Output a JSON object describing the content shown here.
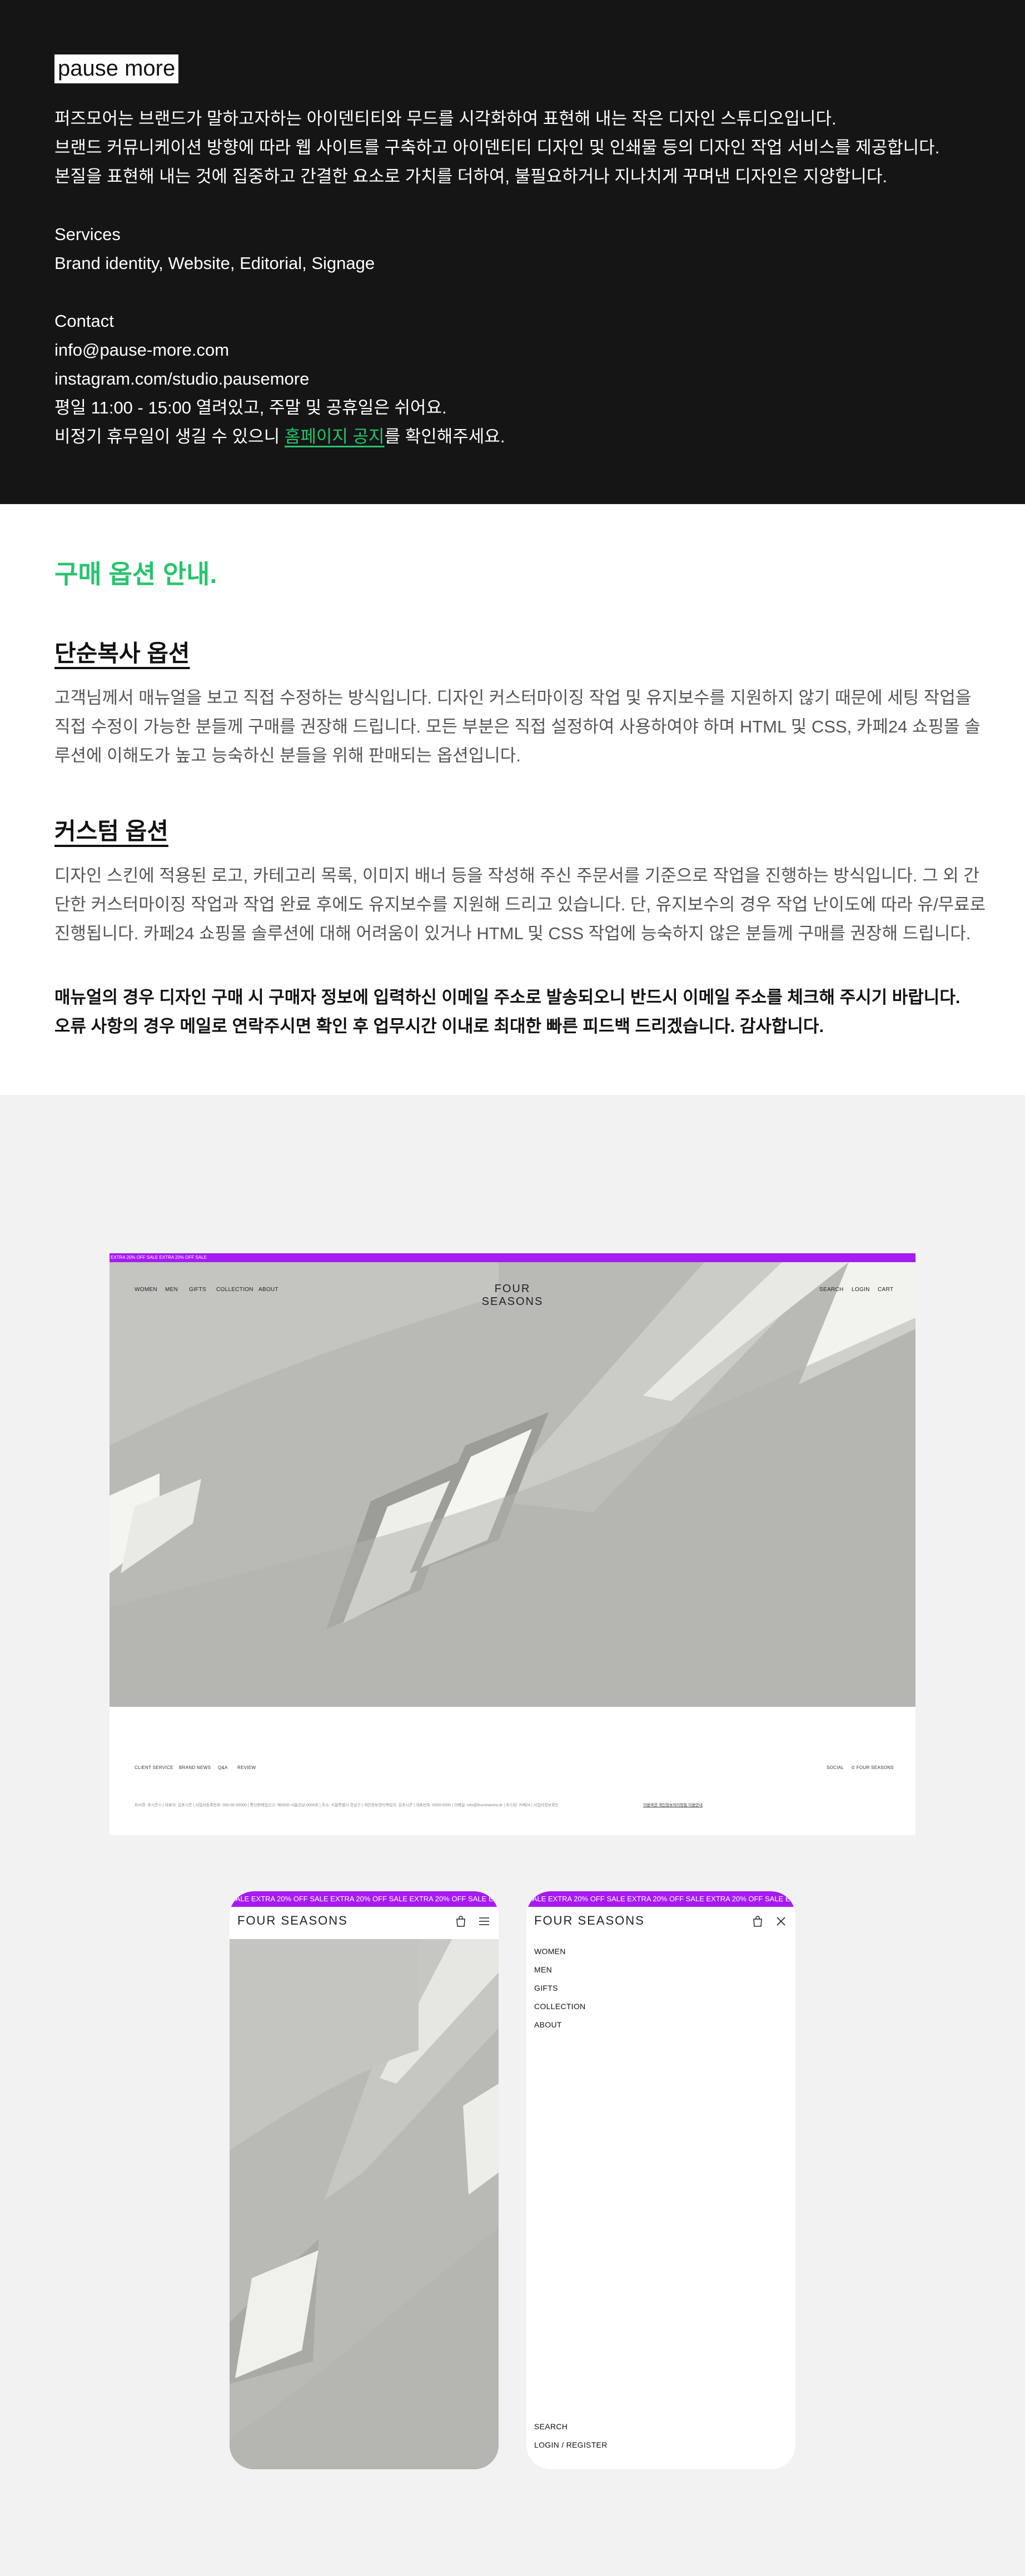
{
  "studio": {
    "logo": "pause more",
    "intro": [
      "퍼즈모어는 브랜드가 말하고자하는 아이덴티티와 무드를 시각화하여 표현해 내는 작은 디자인 스튜디오입니다.",
      "브랜드 커뮤니케이션 방향에 따라 웹 사이트를 구축하고 아이덴티티 디자인 및 인쇄물 등의 디자인 작업 서비스를 제공합니다.",
      "본질을 표현해 내는 것에 집중하고 간결한 요소로 가치를 더하여, 불필요하거나 지나치게 꾸며낸 디자인은 지양합니다."
    ],
    "services_label": "Services",
    "services": "Brand identity, Website, Editorial, Signage",
    "contact_label": "Contact",
    "email": "info@pause-more.com",
    "instagram": "instagram.com/studio.pausemore",
    "hours": "평일 11:00 - 15:00 열려있고, 주말 및 공휴일은 쉬어요.",
    "holiday_prefix": "비정기 휴무일이 생길 수 있으니 ",
    "holiday_link": "홈페이지 공지",
    "holiday_suffix": "를 확인해주세요."
  },
  "purchase": {
    "title": "구매 옵션 안내.",
    "options": [
      {
        "title": "단순복사 옵션",
        "text": "고객님께서 매뉴얼을 보고 직접 수정하는 방식입니다. 디자인 커스터마이징 작업 및 유지보수를 지원하지 않기 때문에 세팅 작업을 직접 수정이 가능한 분들께 구매를 권장해 드립니다. 모든 부분은 직접 설정하여 사용하여야 하며 HTML 및 CSS, 카페24 쇼핑몰 솔루션에 이해도가 높고 능숙하신 분들을 위해 판매되는 옵션입니다."
      },
      {
        "title": "커스텀 옵션",
        "text": "디자인 스킨에 적용된 로고, 카테고리 목록, 이미지 배너 등을 작성해 주신 주문서를 기준으로 작업을 진행하는 방식입니다. 그 외 간단한 커스터마이징 작업과 작업 완료 후에도 유지보수를 지원해 드리고 있습니다. 단, 유지보수의 경우 작업 난이도에 따라 유/무료로 진행됩니다. 카페24 쇼핑몰 솔루션에 대해 어려움이 있거나 HTML 및 CSS 작업에 능숙하지 않은 분들께 구매를 권장해 드립니다."
      }
    ],
    "notice": [
      "매뉴얼의 경우 디자인 구매 시 구매자 정보에 입력하신 이메일 주소로 발송되오니 반드시 이메일 주소를 체크해 주시기 바랍니다.",
      "오류 사항의 경우 메일로 연락주시면 확인 후 업무시간 이내로 최대한 빠른 피드백 드리겠습니다. 감사합니다."
    ]
  },
  "desktop": {
    "promo": "EXTRA 20% OFF SALE     EXTRA 20% OFF SALE",
    "nav_left": [
      "WOMEN",
      "MEN",
      "GIFTS",
      "COLLECTION",
      "ABOUT"
    ],
    "logo": "FOUR SEASONS",
    "nav_right": [
      "SEARCH",
      "LOGIN",
      "CART"
    ],
    "footer_left": [
      "CLIENT SERVICE",
      "BRAND NEWS",
      "Q&A",
      "REVIEW"
    ],
    "footer_right": [
      "SOCIAL",
      "© FOUR SEASONS"
    ],
    "footer_info": "회사명: 포시즌스   |   대표자: 김포시즌   |   사업자등록번호: 000-00-00000   |   통신판매업신고: 제0000-서울강남-0000호   |   주소: 서울특별시 강남구   |   개인정보관리책임자: 김포시즌   |   대표번호: 0000-0000   |   이메일: info@fourseasons.kr   |   호스팅: 카페24   |   사업자정보확인",
    "footer_links": "이용약관   개인정보처리방침   이용안내"
  },
  "mobile": {
    "promo": "SALE   EXTRA 20% OFF SALE   EXTRA 20% OFF SALE   EXTRA 20% OFF SALE   EXTRA 20% OFF SALE",
    "logo": "FOUR SEASONS",
    "menu": [
      "WOMEN",
      "MEN",
      "GIFTS",
      "COLLECTION",
      "ABOUT"
    ],
    "menu_bottom": [
      "SEARCH",
      "LOGIN / REGISTER"
    ]
  },
  "colors": {
    "dark_bg": "#151515",
    "accent_green": "#27c46e",
    "promo_purple": "#a61bf1",
    "hero_gray": "#b8b8b4"
  }
}
